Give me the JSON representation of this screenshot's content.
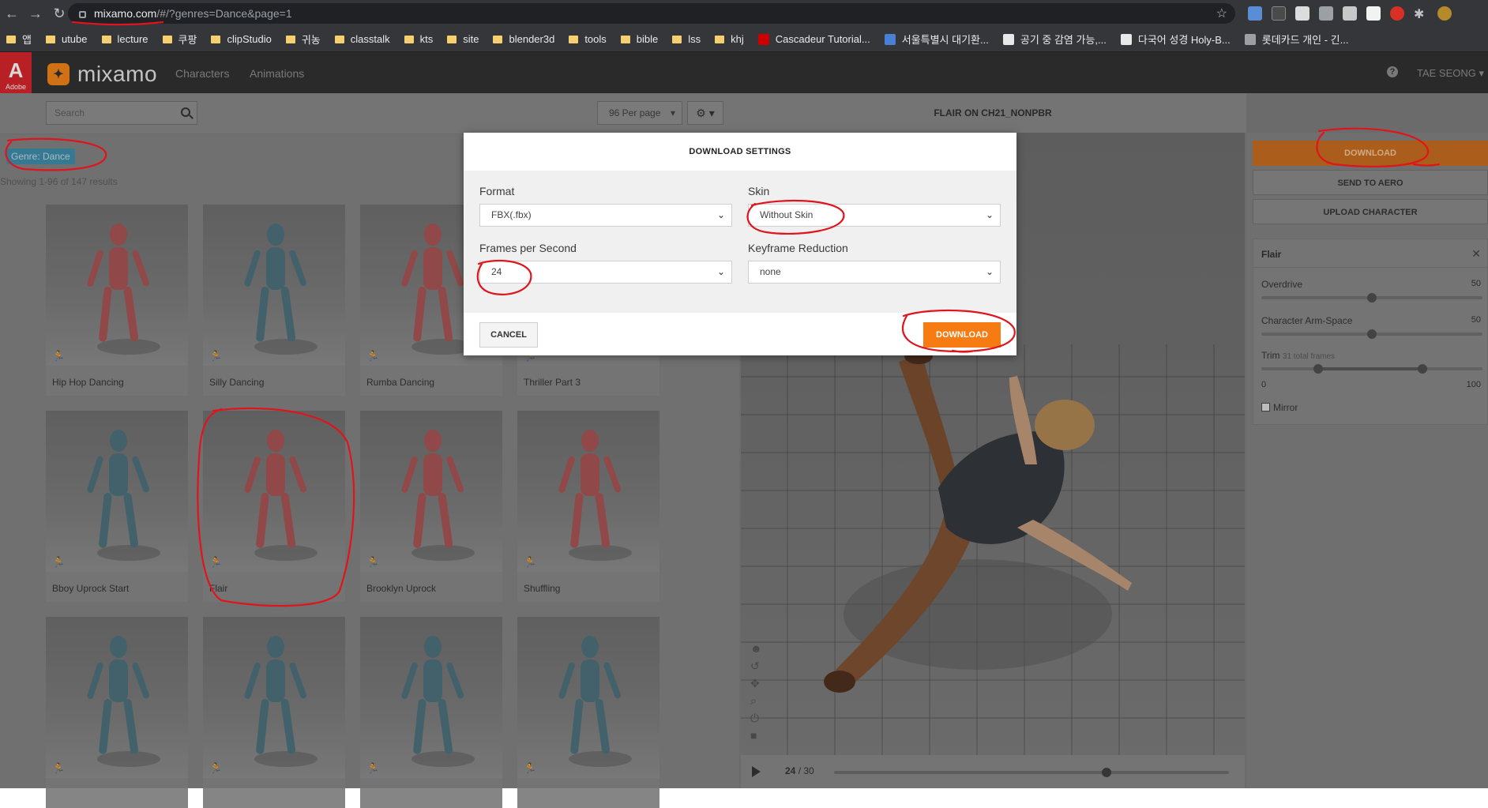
{
  "browser": {
    "url_domain": "mixamo.com",
    "url_rest": "/#/?genres=Dance&page=1",
    "bookmarks": [
      "앱",
      "utube",
      "lecture",
      "쿠팡",
      "clipStudio",
      "귀농",
      "classtalk",
      "kts",
      "site",
      "blender3d",
      "tools",
      "bible",
      "lss",
      "khj",
      "Cascadeur Tutorial...",
      "서울특별시 대기환...",
      "공기 중 감염 가능,...",
      "다국어 성경 Holy-B...",
      "롯데카드 개인 - 긴..."
    ]
  },
  "header": {
    "adobe": "Adobe",
    "logo": "mixamo",
    "nav": [
      "Characters",
      "Animations"
    ],
    "user": "TAE SEONG"
  },
  "library": {
    "search_placeholder": "Search",
    "per_page": "96 Per page",
    "genre_tag": "Genre: Dance",
    "results": "Showing 1-96 of 147 results",
    "cards": [
      "Hip Hop Dancing",
      "Silly Dancing",
      "Rumba Dancing",
      "Thriller Part 3",
      "Bboy Uprock Start",
      "Flair",
      "Brooklyn Uprock",
      "Shuffling",
      "",
      "",
      "",
      ""
    ]
  },
  "viewer": {
    "title": "FLAIR ON CH21_NONPBR",
    "frame_current": "24",
    "frame_total": " / 30",
    "playhead_fraction": 0.69
  },
  "sidebar": {
    "download": "DOWNLOAD",
    "send_to_aero": "SEND TO AERO",
    "upload_character": "UPLOAD CHARACTER",
    "panel_title": "Flair",
    "overdrive_label": "Overdrive",
    "overdrive_value": "50",
    "arm_space_label": "Character Arm-Space",
    "arm_space_value": "50",
    "trim_label": "Trim",
    "trim_note": "31 total frames",
    "trim_min": "0",
    "trim_max": "100",
    "mirror_label": "Mirror"
  },
  "modal": {
    "title": "DOWNLOAD SETTINGS",
    "format_label": "Format",
    "format_value": "FBX(.fbx)",
    "skin_label": "Skin",
    "skin_value": "Without Skin",
    "fps_label": "Frames per Second",
    "fps_value": "24",
    "keyframe_label": "Keyframe Reduction",
    "keyframe_value": "none",
    "cancel": "CANCEL",
    "download": "DOWNLOAD"
  },
  "colors": {
    "accent": "#f67b12",
    "annotation": "#e0141c",
    "genre_tag": "#3a8caa"
  }
}
